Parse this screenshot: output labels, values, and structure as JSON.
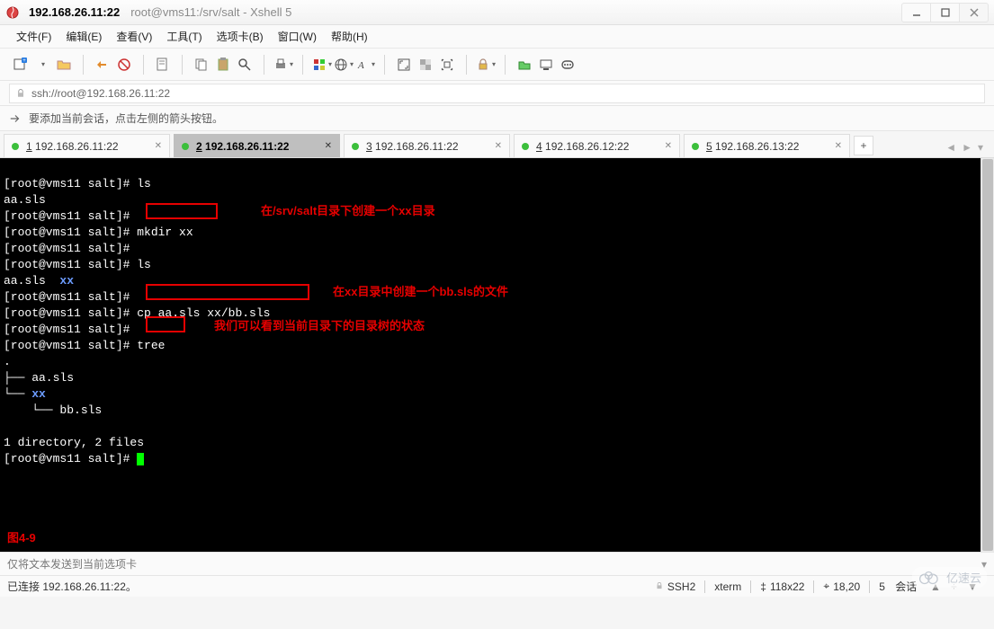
{
  "window": {
    "ip_title": "192.168.26.11:22",
    "suffix": "root@vms11:/srv/salt - Xshell 5"
  },
  "menu": {
    "file": "文件(F)",
    "edit": "编辑(E)",
    "view": "查看(V)",
    "tools": "工具(T)",
    "tabs": "选项卡(B)",
    "window": "窗口(W)",
    "help": "帮助(H)"
  },
  "addressbar": {
    "url": "ssh://root@192.168.26.11:22"
  },
  "tipbar": {
    "text": "要添加当前会话，点击左侧的箭头按钮。"
  },
  "tabs": [
    {
      "num": "1",
      "label": "192.168.26.11:22",
      "active": false
    },
    {
      "num": "2",
      "label": "192.168.26.11:22",
      "active": true
    },
    {
      "num": "3",
      "label": "192.168.26.11:22",
      "active": false
    },
    {
      "num": "4",
      "label": "192.168.26.12:22",
      "active": false
    },
    {
      "num": "5",
      "label": "192.168.26.13:22",
      "active": false
    }
  ],
  "terminal": {
    "lines": [
      "[root@vms11 salt]# ls",
      "aa.sls",
      "[root@vms11 salt]#",
      "[root@vms11 salt]# mkdir xx",
      "[root@vms11 salt]#",
      "[root@vms11 salt]# ls",
      "aa.sls  xx",
      "[root@vms11 salt]#",
      "[root@vms11 salt]# cp aa.sls xx/bb.sls",
      "[root@vms11 salt]#",
      "[root@vms11 salt]# tree",
      ".",
      "├── aa.sls",
      "└── xx",
      "    └── bb.sls",
      "",
      "1 directory, 2 files",
      "[root@vms11 salt]# "
    ],
    "annotations": {
      "ann1": "在/srv/salt目录下创建一个xx目录",
      "ann2": "在xx目录中创建一个bb.sls的文件",
      "ann3": "我们可以看到当前目录下的目录树的状态",
      "fig": "图4-9"
    }
  },
  "sendbar": {
    "placeholder": "仅将文本发送到当前选项卡"
  },
  "status": {
    "connected": "已连接 192.168.26.11:22。",
    "proto": "SSH2",
    "term": "xterm",
    "size": "118x22",
    "pos": "18,20",
    "sessions_label": "会话",
    "sessions_count": "5"
  },
  "watermark": {
    "text": "亿速云"
  }
}
